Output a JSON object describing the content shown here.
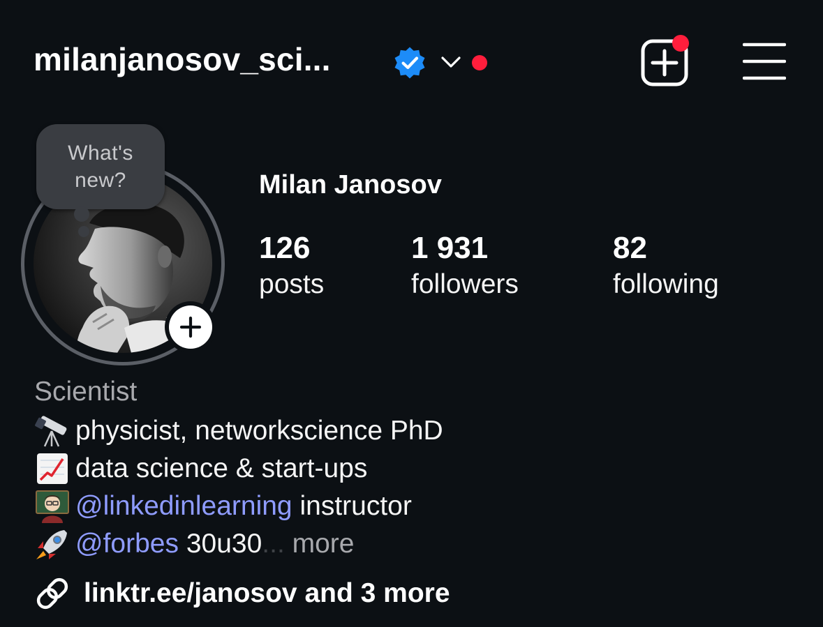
{
  "header": {
    "username": "milanjanosov_sci...",
    "verified_icon": "verified-badge-icon",
    "chevron_icon": "chevron-down-icon",
    "new_post_icon": "new-post-icon",
    "menu_icon": "menu-icon",
    "accent_red": "#ff1e3c",
    "verified_blue": "#1d8cf8"
  },
  "note": {
    "text": "What's new?"
  },
  "profile": {
    "full_name": "Milan Janosov",
    "add_story_icon": "plus-icon"
  },
  "stats": [
    {
      "value": "126",
      "label": "posts"
    },
    {
      "value": "1 931",
      "label": "followers"
    },
    {
      "value": "82",
      "label": "following"
    }
  ],
  "bio": {
    "category": "Scientist",
    "lines": [
      {
        "emoji": "telescope-icon",
        "text": "physicist, networkscience PhD"
      },
      {
        "emoji": "chart-increasing-icon",
        "text": "data science & start-ups"
      },
      {
        "emoji": "teacher-icon",
        "mention": "@linkedinlearning",
        "text": " instructor"
      },
      {
        "emoji": "rocket-icon",
        "mention": "@forbes",
        "text": " 30u30",
        "ellipsis": "...",
        "more": " more"
      }
    ],
    "mention_color": "#8f9cff"
  },
  "link": {
    "icon": "link-icon",
    "text": "linktr.ee/janosov and 3 more"
  }
}
